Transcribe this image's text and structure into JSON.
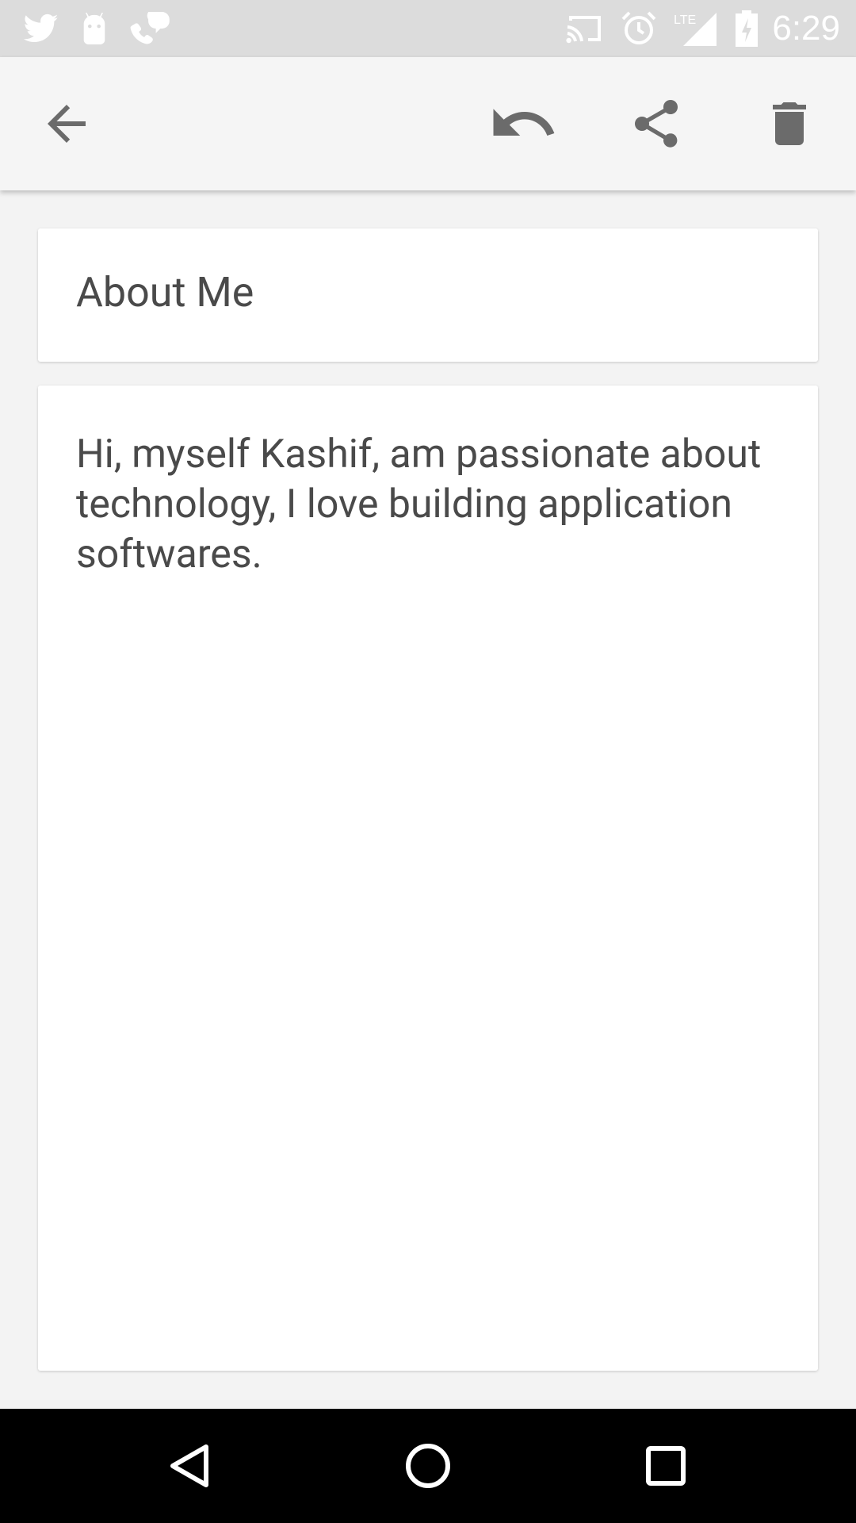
{
  "status_bar": {
    "time": "6:29",
    "left_icons": [
      "twitter-icon",
      "android-icon",
      "hangouts-dialer-icon"
    ],
    "right_icons": [
      "cast-icon",
      "alarm-icon",
      "lte-signal-icon",
      "battery-charging-icon"
    ],
    "network_label": "LTE"
  },
  "toolbar": {
    "actions": [
      "back-arrow-icon",
      "undo-icon",
      "share-icon",
      "delete-icon"
    ]
  },
  "note": {
    "title": "About Me",
    "body": "Hi, myself Kashif, am passionate about technology, I love building application softwares."
  },
  "nav_bar": {
    "buttons": [
      "nav-back-icon",
      "nav-home-icon",
      "nav-recents-icon"
    ]
  },
  "colors": {
    "status_bar_bg": "#dcdcdc",
    "toolbar_bg": "#f5f5f5",
    "page_bg": "#f3f3f3",
    "card_bg": "#ffffff",
    "text": "#4a4a4a",
    "icon": "#6b6b6b",
    "nav_bar_bg": "#000000"
  }
}
